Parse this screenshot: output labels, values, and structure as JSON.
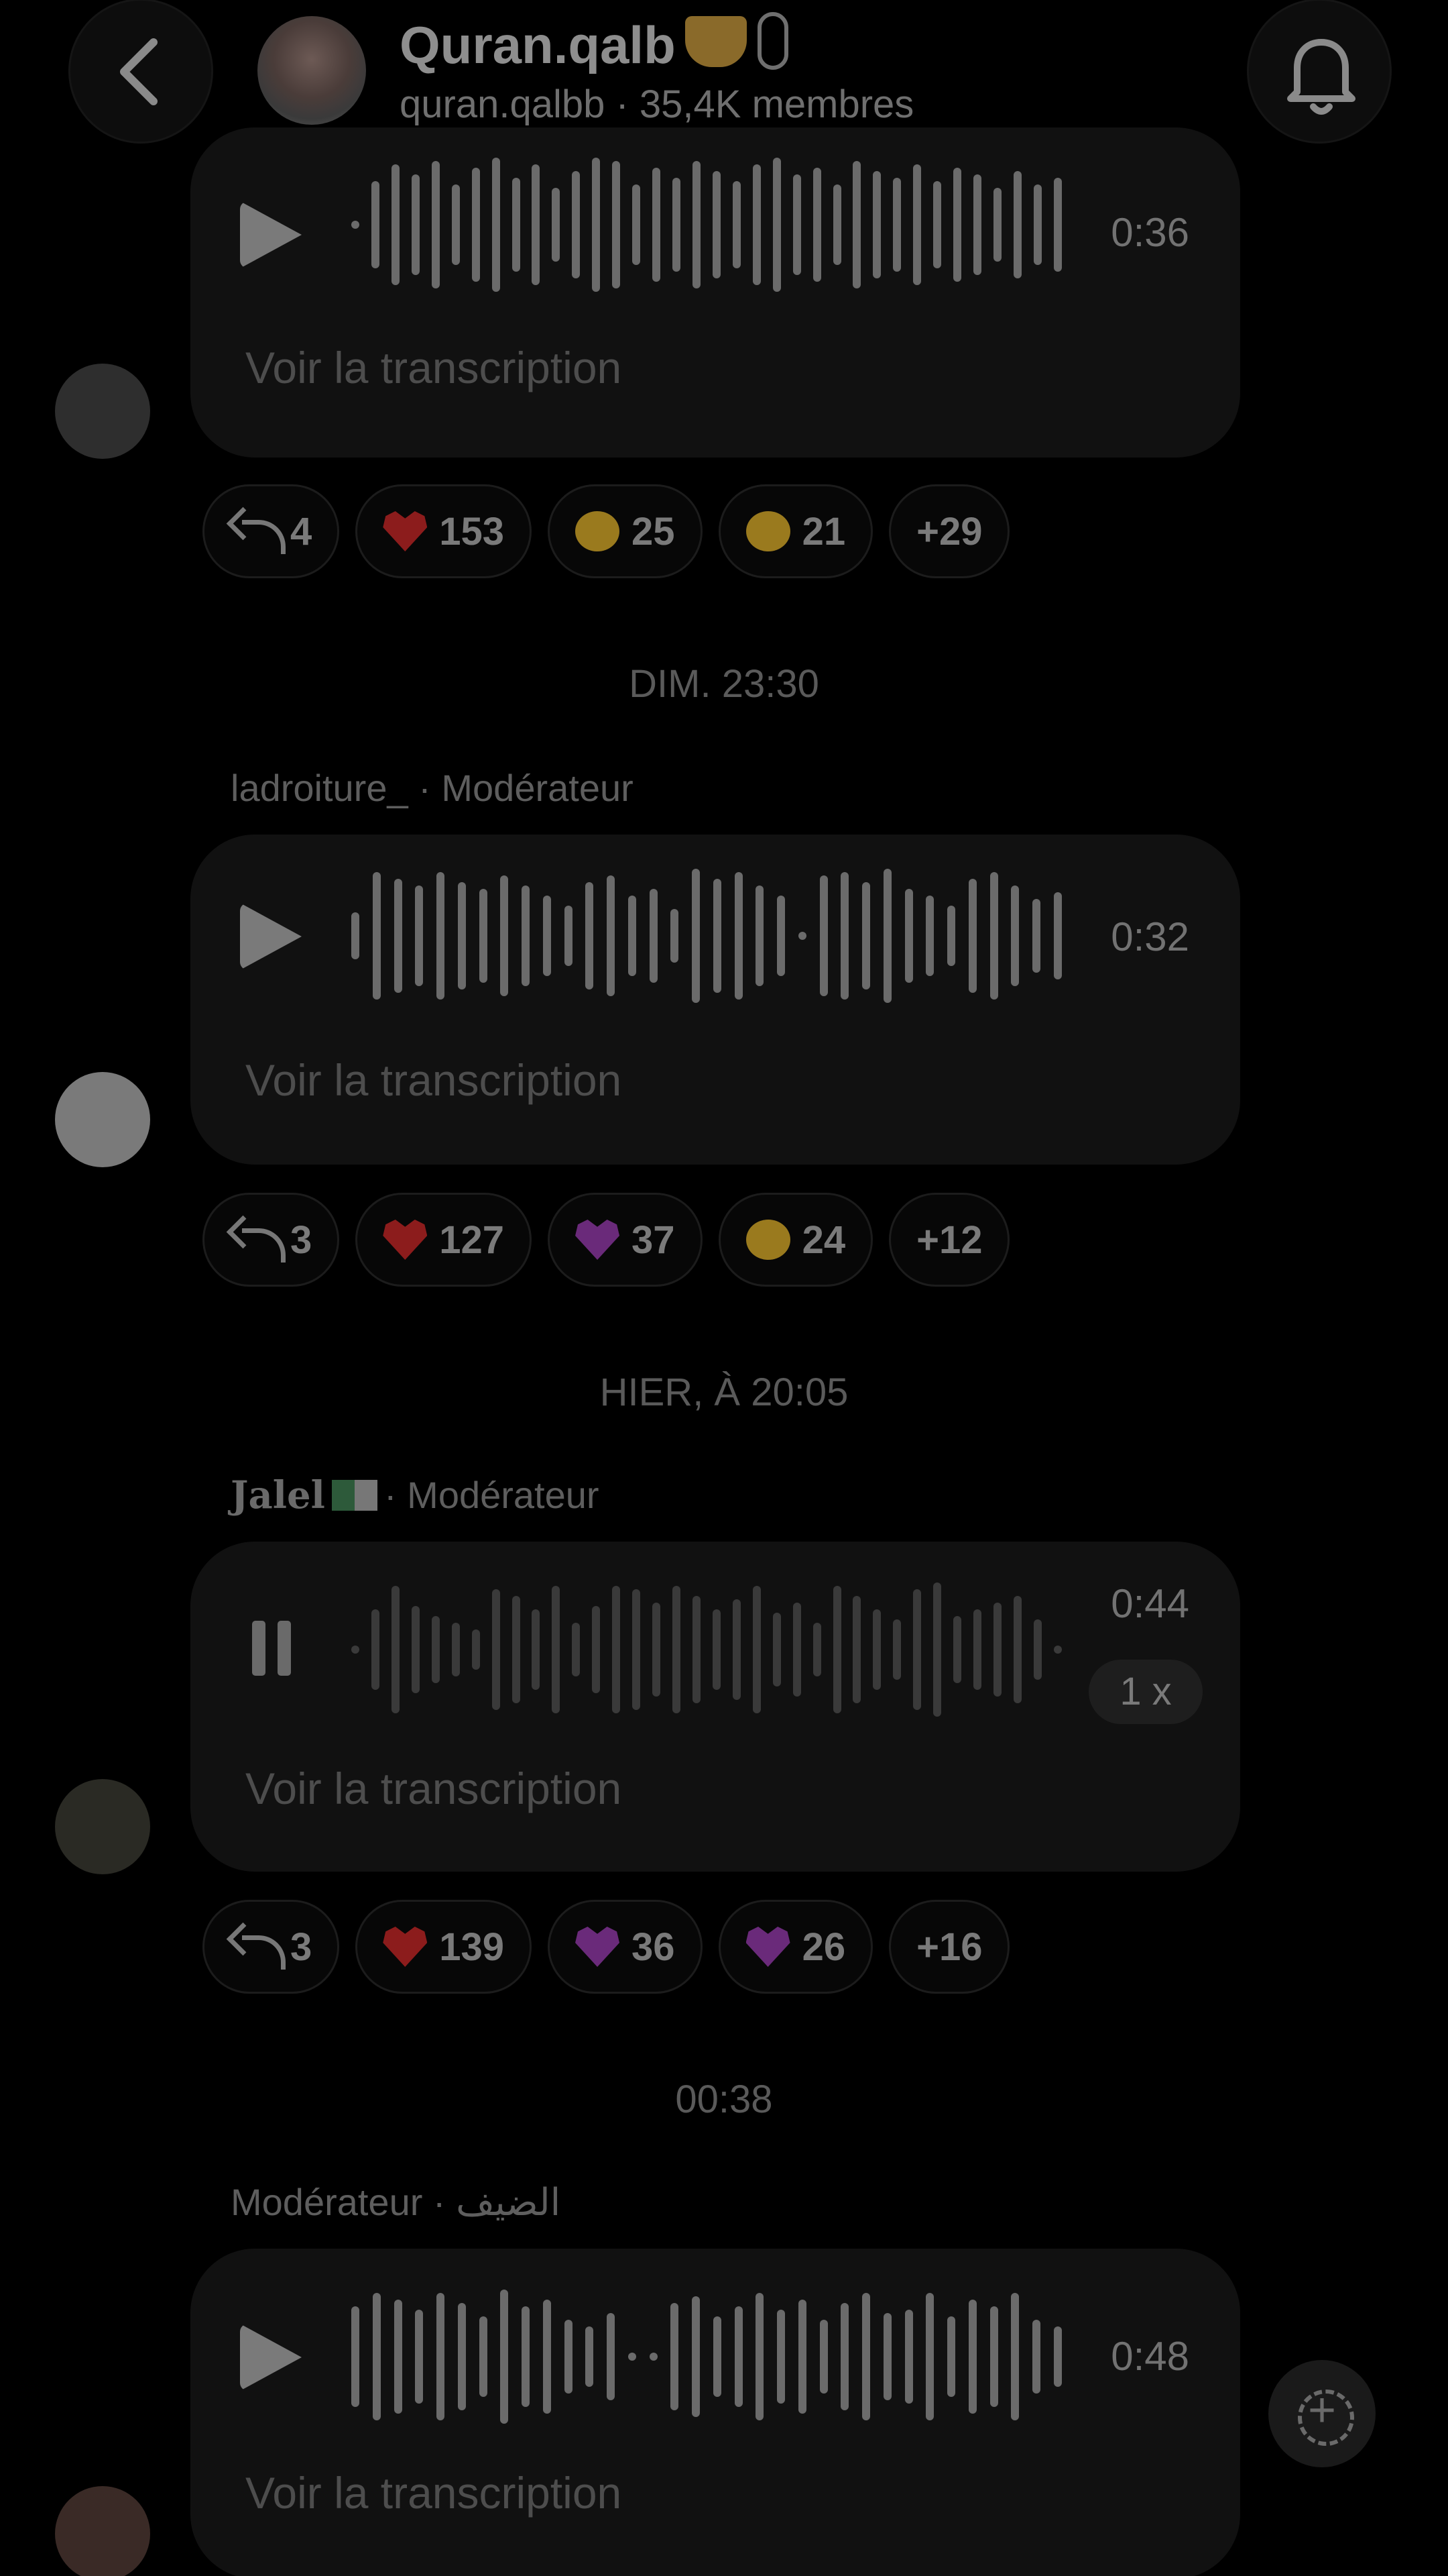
{
  "header": {
    "title": "Quran.qalb",
    "subtitle": "quran.qalbb · 35,4K membres",
    "back_icon": "chevron-left-icon",
    "bell_icon": "bell-icon"
  },
  "messages": [
    {
      "sender": "",
      "role": "",
      "duration": "0:36",
      "state": "paused",
      "transcript_label": "Voir la transcription",
      "reactions": {
        "replies": "4",
        "items": [
          {
            "icon": "red-heart-icon",
            "count": "153"
          },
          {
            "icon": "heart-eyes-emoji-icon",
            "count": "25"
          },
          {
            "icon": "pleading-face-emoji-icon",
            "count": "21"
          }
        ],
        "more": "+29"
      }
    },
    {
      "date_divider": "DIM. 23:30",
      "sender": "ladroiture_",
      "role": "· Modérateur",
      "duration": "0:32",
      "state": "paused",
      "transcript_label": "Voir la transcription",
      "reactions": {
        "replies": "3",
        "items": [
          {
            "icon": "red-heart-icon",
            "count": "127"
          },
          {
            "icon": "purple-heart-icon",
            "count": "37"
          },
          {
            "icon": "smiling-hearts-emoji-icon",
            "count": "24"
          }
        ],
        "more": "+12"
      }
    },
    {
      "date_divider": "HIER, À 20:05",
      "sender": "Jalel",
      "role": "· Modérateur",
      "duration": "0:44",
      "speed": "1 x",
      "state": "playing",
      "transcript_label": "Voir la transcription",
      "reactions": {
        "replies": "3",
        "items": [
          {
            "icon": "red-heart-icon",
            "count": "139"
          },
          {
            "icon": "purple-heart-icon",
            "count": "36"
          },
          {
            "icon": "purple-heart-icon",
            "count": "26"
          }
        ],
        "more": "+16"
      }
    },
    {
      "date_divider": "00:38",
      "sender": "Modérateur · الضيف",
      "role": "",
      "duration": "0:48",
      "state": "paused",
      "transcript_label": "Voir la transcription"
    }
  ],
  "fab": {
    "icon": "add-circle-icon"
  }
}
